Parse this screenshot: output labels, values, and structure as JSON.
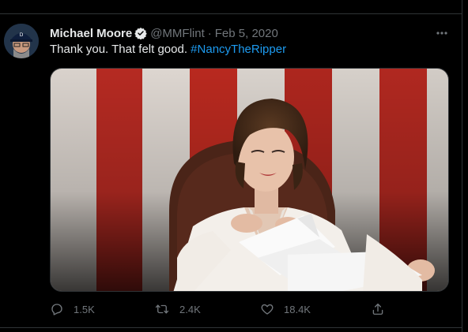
{
  "tweet": {
    "author_name": "Michael Moore",
    "handle": "@MMFlint",
    "separator": "·",
    "date": "Feb 5, 2020",
    "verified": true,
    "text_plain": "Thank you. That felt good. ",
    "text_hashtag": "#NancyTheRipper",
    "more_icon": "more-horizontal-icon"
  },
  "media": {
    "icon": "photo",
    "description": "Woman in white suit tearing papers in front of American flag"
  },
  "actions": {
    "reply_count": "1.5K",
    "retweet_count": "2.4K",
    "like_count": "18.4K"
  },
  "colors": {
    "background": "#000000",
    "text": "#e7e9ea",
    "secondary": "#71767b",
    "link": "#1d9bf0",
    "border": "#2f3336"
  }
}
